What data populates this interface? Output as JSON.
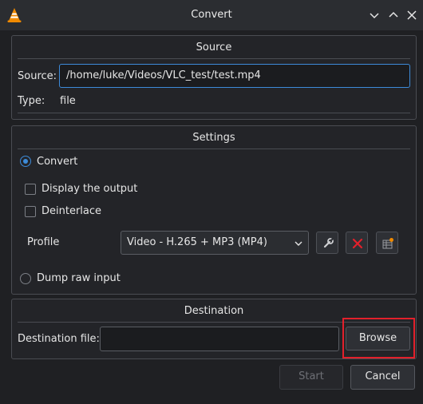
{
  "window": {
    "title": "Convert"
  },
  "icons": {
    "app": "vlc-cone-icon",
    "minimize": "chevron-down-icon",
    "maximize": "chevron-up-icon",
    "close": "close-icon",
    "edit_profile": "wrench-icon",
    "delete_profile": "red-x-icon",
    "new_profile": "new-profile-icon"
  },
  "colors": {
    "accent": "#3d8bd9",
    "delete": "#e2202b",
    "highlight": "#e2202b",
    "vlc_orange": "#f08a00"
  },
  "source": {
    "heading": "Source",
    "source_label": "Source:",
    "source_value": "/home/luke/Videos/VLC_test/test.mp4",
    "type_label": "Type:",
    "type_value": "file"
  },
  "settings": {
    "heading": "Settings",
    "convert_label": "Convert",
    "convert_selected": true,
    "display_output_label": "Display the output",
    "display_output_checked": false,
    "deinterlace_label": "Deinterlace",
    "deinterlace_checked": false,
    "profile_label": "Profile",
    "profile_value": "Video - H.265 + MP3 (MP4)",
    "dump_raw_label": "Dump raw input",
    "dump_raw_selected": false
  },
  "destination": {
    "heading": "Destination",
    "file_label": "Destination file:",
    "file_value": "",
    "browse_label": "Browse"
  },
  "footer": {
    "start_label": "Start",
    "start_enabled": false,
    "cancel_label": "Cancel"
  }
}
